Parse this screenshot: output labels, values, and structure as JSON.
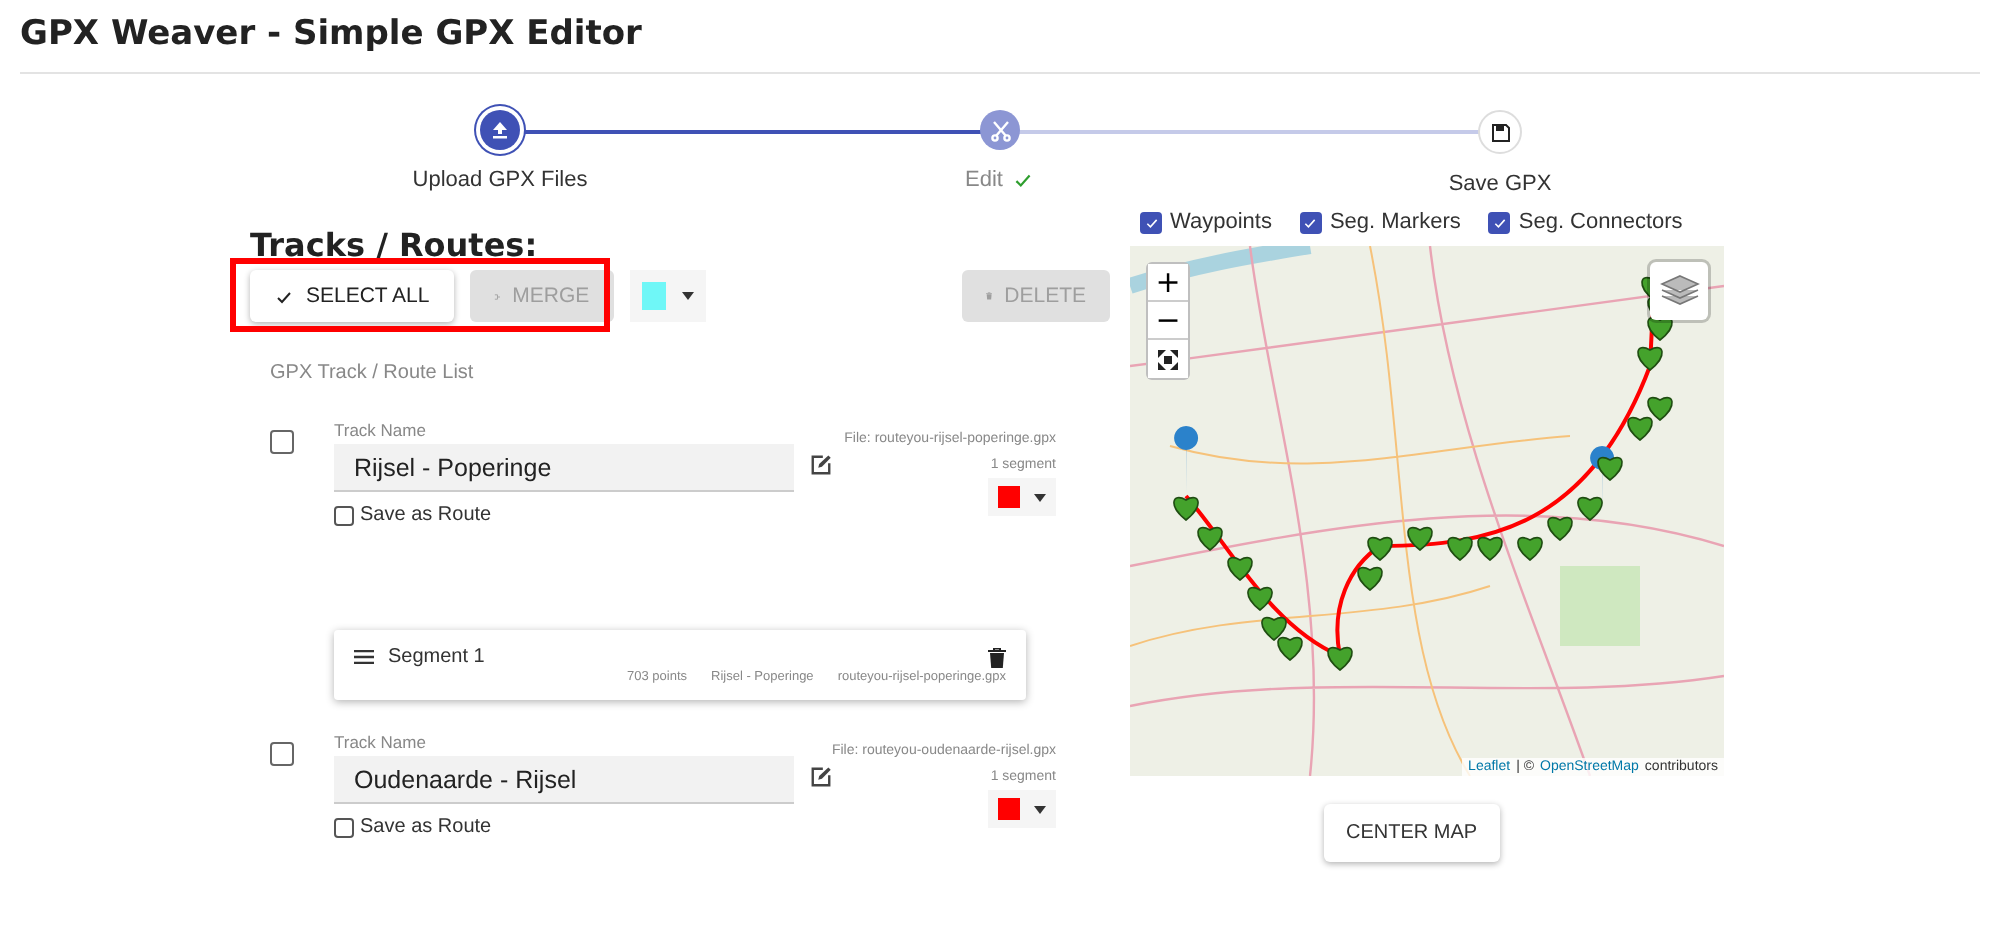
{
  "header": {
    "title": "GPX Weaver - Simple GPX Editor"
  },
  "steps": [
    {
      "label": "Upload GPX Files",
      "completed": true,
      "selected": false,
      "checked": false
    },
    {
      "label": "Edit",
      "completed": false,
      "selected": true,
      "checked": true
    },
    {
      "label": "Save GPX",
      "completed": false,
      "selected": false,
      "checked": false
    }
  ],
  "tracks_panel": {
    "heading": "Tracks / Routes:",
    "select_all": "SELECT ALL",
    "merge": {
      "label": "MERGE",
      "disabled": true
    },
    "delete": {
      "label": "DELETE",
      "disabled": true
    },
    "list_title": "GPX Track / Route List"
  },
  "tracks": [
    {
      "checked": false,
      "name_label": "Track Name",
      "name": "Rijsel - Poperinge",
      "save_as_route_label": "Save as Route",
      "save_as_route": false,
      "file": "File: routeyou-rijsel-poperinge.gpx",
      "segment_count": "1 segment",
      "color": "#ff0000",
      "segments": [
        {
          "title": "Segment 1",
          "points": "703 points",
          "track": "Rijsel - Poperinge",
          "file": "routeyou-rijsel-poperinge.gpx"
        }
      ]
    },
    {
      "checked": false,
      "name_label": "Track Name",
      "name": "Oudenaarde - Rijsel",
      "save_as_route_label": "Save as Route",
      "save_as_route": false,
      "file": "File: routeyou-oudenaarde-rijsel.gpx",
      "segment_count": "1 segment",
      "color": "#ff0000"
    }
  ],
  "map_options": [
    {
      "label": "Waypoints",
      "checked": true
    },
    {
      "label": "Seg. Markers",
      "checked": true
    },
    {
      "label": "Seg. Connectors",
      "checked": true
    }
  ],
  "map": {
    "zoom_in": "+",
    "zoom_out": "−",
    "attribution_link_1": "Leaflet",
    "attribution_sep": "| ©",
    "attribution_link_2": "OpenStreetMap",
    "attribution_tail": "contributors"
  },
  "center_map": "CENTER MAP"
}
